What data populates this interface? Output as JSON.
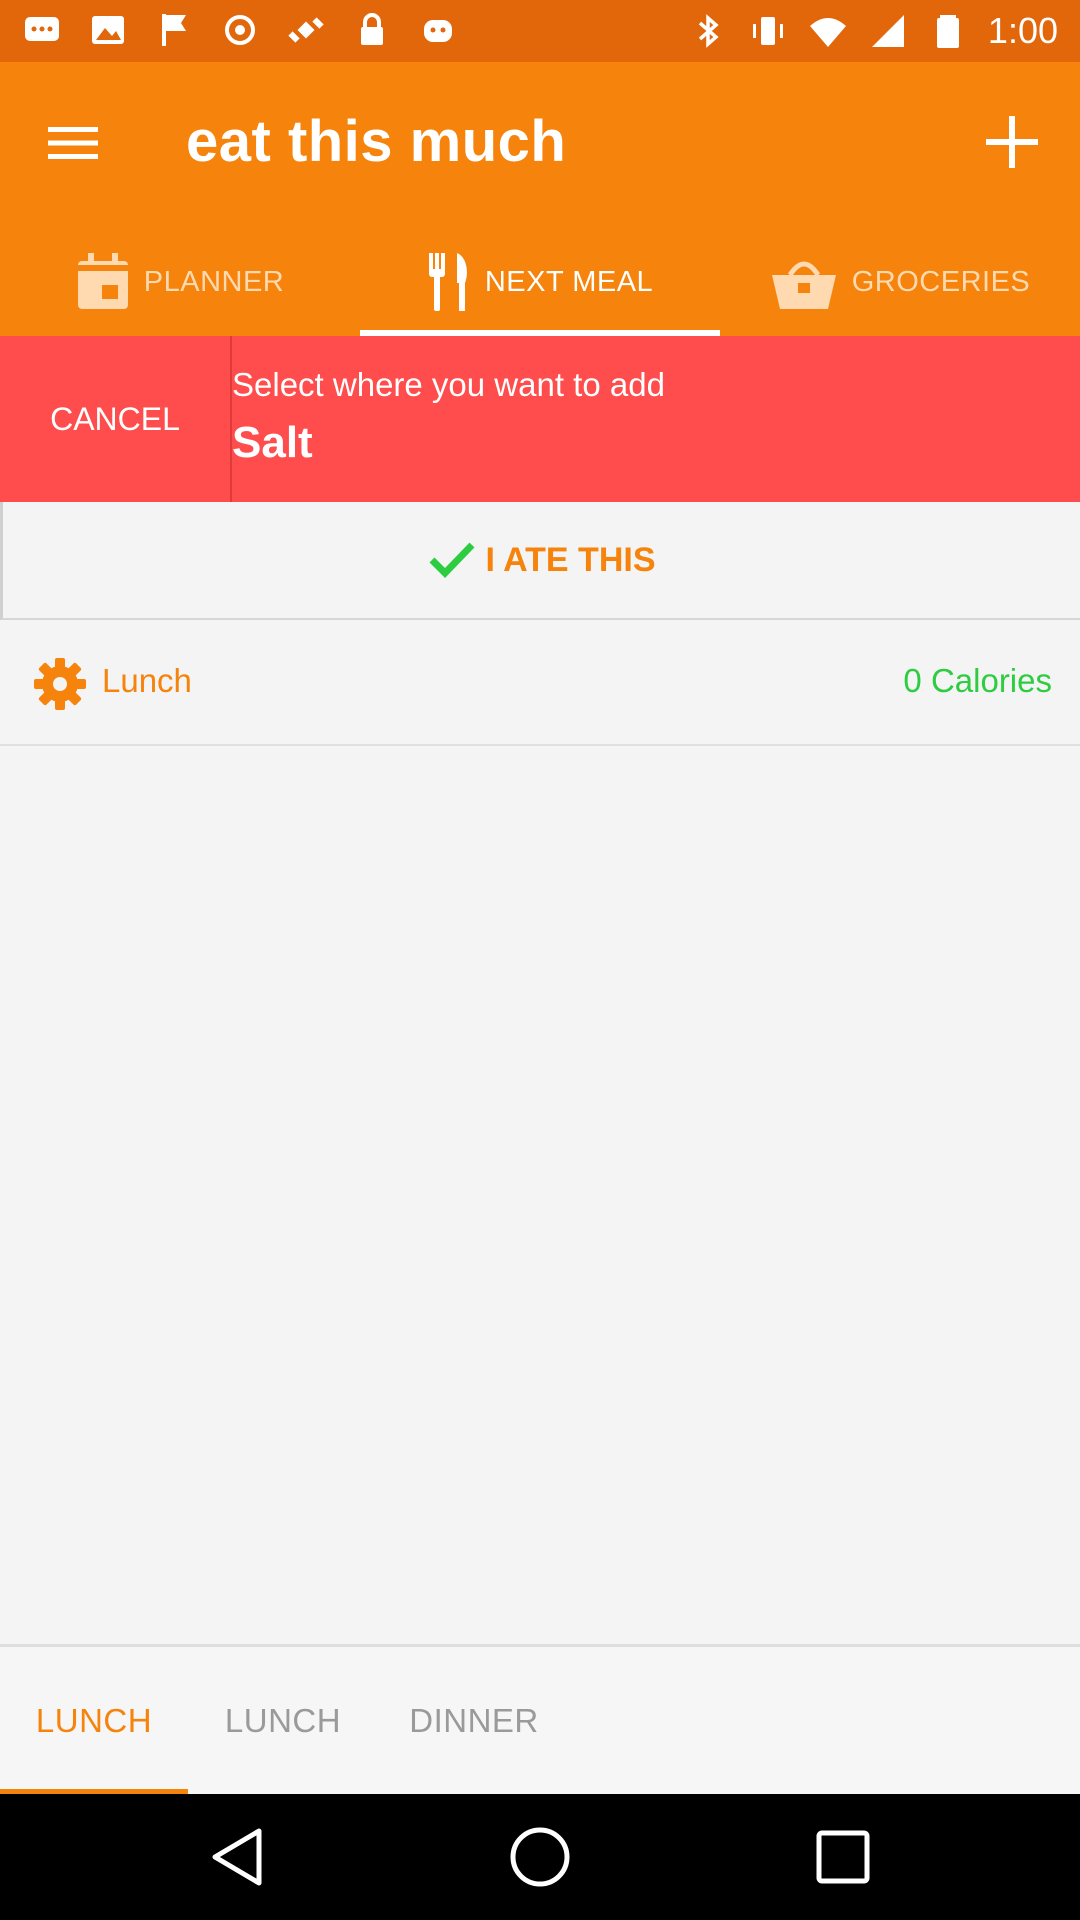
{
  "status_bar": {
    "time": "1:00",
    "icons_left": [
      "messages-icon",
      "image-icon",
      "flag-icon",
      "sync-icon",
      "satellite-icon",
      "lock-icon",
      "android-icon"
    ],
    "icons_right": [
      "bluetooth-icon",
      "vibrate-icon",
      "wifi-icon",
      "signal-icon",
      "battery-icon"
    ]
  },
  "app_bar": {
    "title": "eat this much",
    "menu_icon": "hamburger-menu-icon",
    "add_icon": "plus-icon"
  },
  "tabs": [
    {
      "label": "PLANNER",
      "icon": "calendar-icon",
      "active": false
    },
    {
      "label": "NEXT MEAL",
      "icon": "utensils-icon",
      "active": true
    },
    {
      "label": "GROCERIES",
      "icon": "basket-icon",
      "active": false
    }
  ],
  "banner": {
    "cancel_label": "CANCEL",
    "message": "Select where you want to add",
    "food": "Salt"
  },
  "ate_button": {
    "label": "I ATE THIS",
    "icon": "checkmark-icon"
  },
  "meal": {
    "name": "Lunch",
    "calories": "0 Calories",
    "icon": "gear-icon"
  },
  "bottom_tabs": [
    {
      "label": "LUNCH",
      "active": true
    },
    {
      "label": "LUNCH",
      "active": false
    },
    {
      "label": "DINNER",
      "active": false
    }
  ],
  "nav_bar": {
    "icons": [
      "back-icon",
      "home-icon",
      "recents-icon"
    ]
  },
  "colors": {
    "primary": "#f5830c",
    "status_bar": "#e2660a",
    "banner": "#ff4c4c",
    "calories": "#2ecc40",
    "inactive": "#9a9a9a"
  }
}
